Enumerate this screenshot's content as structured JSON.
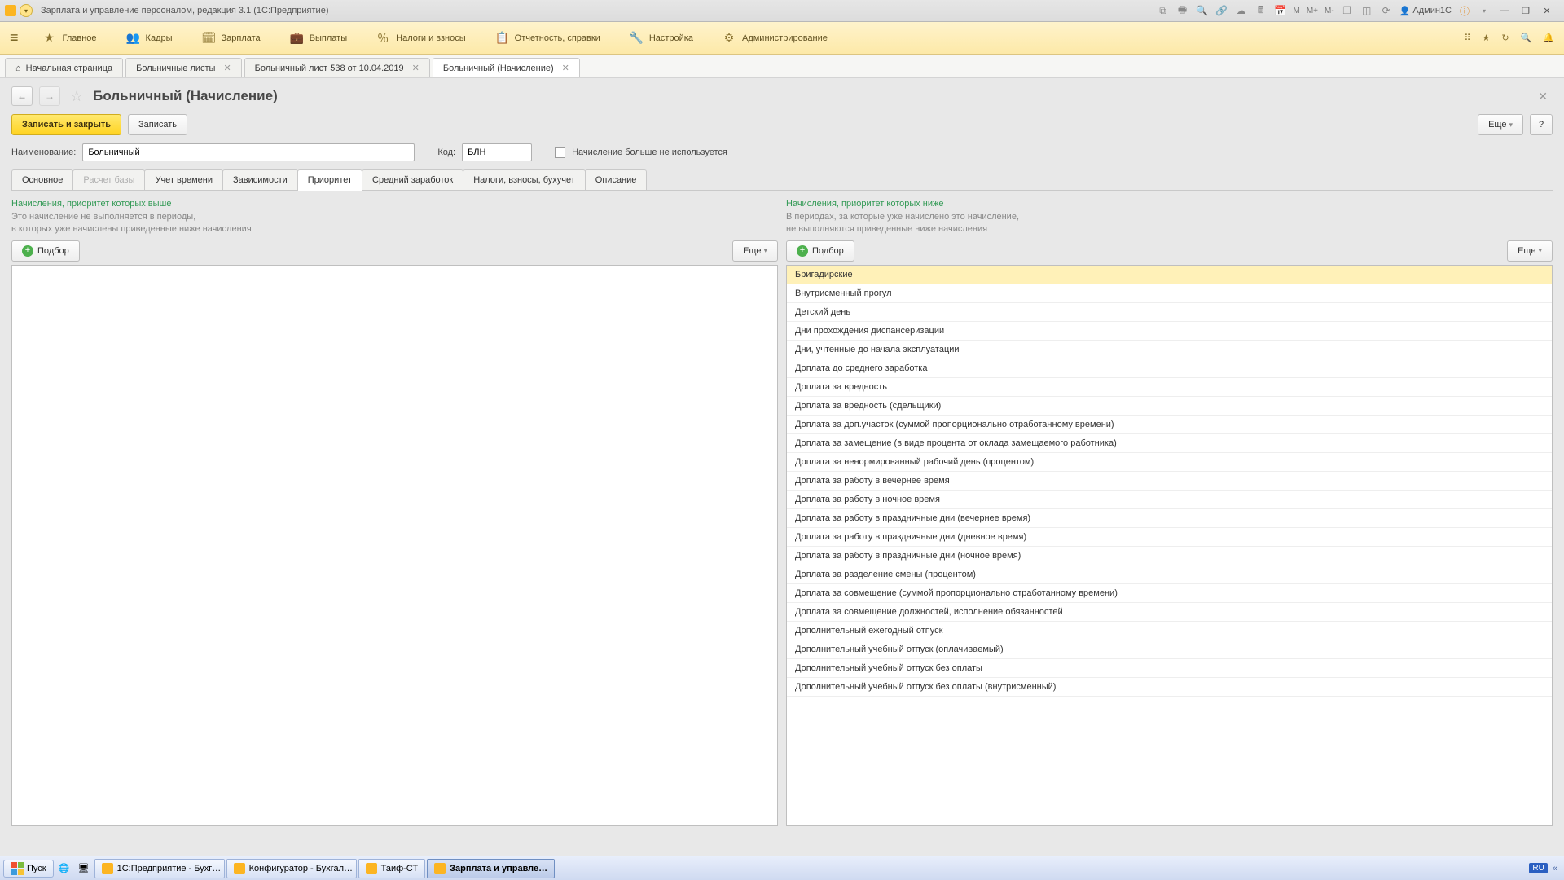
{
  "titlebar": {
    "title": "Зарплата и управление персоналом, редакция 3.1  (1С:Предприятие)",
    "icons_rm": [
      "M",
      "M+",
      "M-"
    ],
    "user": "Админ1С"
  },
  "mainmenu": [
    {
      "icon": "★",
      "label": "Главное"
    },
    {
      "icon": "👥",
      "label": "Кадры"
    },
    {
      "icon": "🗓",
      "label": "Зарплата"
    },
    {
      "icon": "💼",
      "label": "Выплаты"
    },
    {
      "icon": "％",
      "label": "Налоги и взносы"
    },
    {
      "icon": "📋",
      "label": "Отчетность, справки"
    },
    {
      "icon": "🔧",
      "label": "Настройка"
    },
    {
      "icon": "⚙",
      "label": "Администрирование"
    }
  ],
  "tabs": [
    {
      "label": "Начальная страница",
      "home": true,
      "close": false
    },
    {
      "label": "Больничные листы",
      "close": true
    },
    {
      "label": "Больничный лист 538 от 10.04.2019",
      "close": true
    },
    {
      "label": "Больничный (Начисление)",
      "close": true,
      "active": true
    }
  ],
  "page": {
    "title": "Больничный (Начисление)"
  },
  "buttons": {
    "save_close": "Записать и закрыть",
    "save": "Записать",
    "more": "Еще",
    "help": "?",
    "podbor": "Подбор"
  },
  "form": {
    "name_label": "Наименование:",
    "name_value": "Больничный",
    "code_label": "Код:",
    "code_value": "БЛН",
    "unused_label": "Начисление больше не используется"
  },
  "inntabs": [
    "Основное",
    "Расчет базы",
    "Учет времени",
    "Зависимости",
    "Приоритет",
    "Средний заработок",
    "Налоги, взносы, бухучет",
    "Описание"
  ],
  "inntabs_active": 4,
  "inntabs_disabled": [
    1
  ],
  "left_panel": {
    "title": "Начисления, приоритет которых выше",
    "desc1": "Это начисление не выполняется в периоды,",
    "desc2": "в которых уже начислены приведенные ниже начисления"
  },
  "right_panel": {
    "title": "Начисления, приоритет которых ниже",
    "desc1": "В периодах, за которые уже начислено это начисление,",
    "desc2": "не выполняются приведенные ниже начисления",
    "items": [
      "Бригадирские",
      "Внутрисменный прогул",
      "Детский день",
      "Дни прохождения диспансеризации",
      "Дни, учтенные до начала эксплуатации",
      "Доплата до среднего заработка",
      "Доплата за вредность",
      "Доплата за вредность (сдельщики)",
      "Доплата за доп.участок (суммой пропорционально отработанному времени)",
      "Доплата за замещение (в виде процента от оклада замещаемого работника)",
      "Доплата за ненормированный рабочий день (процентом)",
      "Доплата за работу в вечернее время",
      "Доплата за работу в ночное время",
      "Доплата за работу в праздничные дни (вечернее время)",
      "Доплата за работу в праздничные дни (дневное время)",
      "Доплата за работу в праздничные дни (ночное время)",
      "Доплата за разделение смены (процентом)",
      "Доплата за совмещение (суммой пропорционально отработанному времени)",
      "Доплата за совмещение должностей, исполнение обязанностей",
      "Дополнительный ежегодный отпуск",
      "Дополнительный учебный отпуск (оплачиваемый)",
      "Дополнительный учебный отпуск без оплаты",
      "Дополнительный учебный отпуск без оплаты (внутрисменный)"
    ]
  },
  "taskbar": {
    "start": "Пуск",
    "tasks": [
      {
        "label": "1С:Предприятие - Бухг…"
      },
      {
        "label": "Конфигуратор - Бухгал…"
      },
      {
        "label": "Таиф-СТ"
      },
      {
        "label": "Зарплата и управле…",
        "active": true
      }
    ],
    "lang": "RU"
  }
}
